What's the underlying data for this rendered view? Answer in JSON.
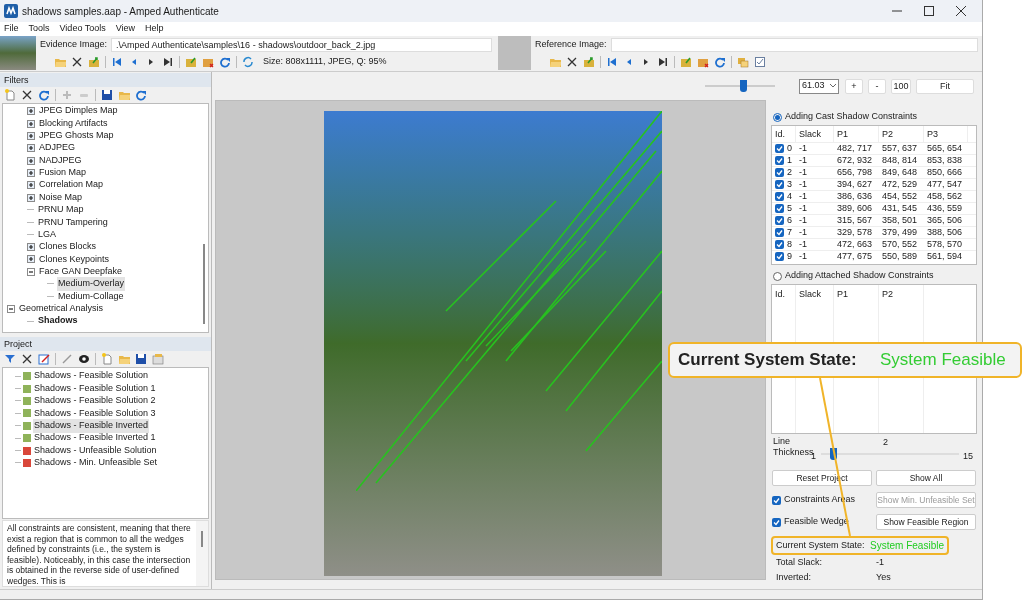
{
  "window": {
    "title": "shadows samples.aap - Amped Authenticate"
  },
  "menu": [
    "File",
    "Tools",
    "Video Tools",
    "View",
    "Help"
  ],
  "evidence": {
    "label": "Evidence Image:",
    "path": ".\\Amped Authenticate\\samples\\16 - shadows\\outdoor_back_2.jpg",
    "info": "Size: 808x1111, JPEG, Q: 95%"
  },
  "reference": {
    "label": "Reference Image:"
  },
  "filters": {
    "title": "Filters",
    "continued_children": [
      {
        "label": "JPEG Dimples Map",
        "expanded": false,
        "selected": false,
        "active": false
      },
      {
        "label": "Blocking Artifacts",
        "expanded": false,
        "selected": false,
        "active": false
      },
      {
        "label": "JPEG Ghosts Map",
        "expanded": false,
        "selected": false,
        "active": false
      },
      {
        "label": "ADJPEG",
        "expanded": false,
        "selected": false,
        "active": false
      },
      {
        "label": "NADJPEG",
        "expanded": false,
        "selected": false,
        "active": false
      },
      {
        "label": "Fusion Map",
        "expanded": false,
        "selected": false,
        "active": false
      },
      {
        "label": "Correlation Map",
        "expanded": false,
        "selected": false,
        "active": false
      },
      {
        "label": "Noise Map",
        "expanded": false,
        "selected": false,
        "active": false
      },
      {
        "label": "PRNU Map",
        "selected": false,
        "active": false
      },
      {
        "label": "PRNU Tampering",
        "selected": false,
        "active": false
      },
      {
        "label": "LGA",
        "selected": false,
        "active": false
      },
      {
        "label": "Clones Blocks",
        "expanded": false,
        "selected": false,
        "active": false
      },
      {
        "label": "Clones Keypoints",
        "expanded": false,
        "selected": false,
        "active": false
      },
      {
        "label": "Face GAN Deepfake",
        "expanded": true,
        "selected": false,
        "active": false,
        "children": [
          {
            "label": "Medium-Overlay",
            "selected": true,
            "active": false
          },
          {
            "label": "Medium-Collage",
            "selected": false,
            "active": false
          }
        ]
      }
    ],
    "nodes": [
      {
        "label": "Geometrical Analysis",
        "expanded": true,
        "selected": false,
        "active": false,
        "children": [
          {
            "label": "Shadows",
            "selected": false,
            "active": true
          }
        ]
      }
    ]
  },
  "project": {
    "title": "Project",
    "items": [
      {
        "label": "Shadows - Feasible Solution",
        "color": "#8fb35a",
        "selected": false
      },
      {
        "label": "Shadows - Feasible Solution 1",
        "color": "#8fb35a",
        "selected": false
      },
      {
        "label": "Shadows - Feasible Solution 2",
        "color": "#8fb35a",
        "selected": false
      },
      {
        "label": "Shadows - Feasible Solution 3",
        "color": "#8fb35a",
        "selected": false
      },
      {
        "label": "Shadows - Feasible Inverted",
        "color": "#8fb35a",
        "selected": true
      },
      {
        "label": "Shadows - Feasible Inverted 1",
        "color": "#8fb35a",
        "selected": false
      },
      {
        "label": "Shadows - Unfeasible Solution",
        "color": "#d9473a",
        "selected": false
      },
      {
        "label": "Shadows - Min. Unfeasible Set",
        "color": "#d9473a",
        "selected": false
      }
    ],
    "description": "All constraints are consistent, meaning that there exist a region that is common to all the wedges defined by constraints (i.e., the system is feasible). Noticeably, in this case the intersection is obtained in the reverse side of user-defined wedges. This is"
  },
  "zoom": {
    "level": 0.55,
    "value": "61.03",
    "buttons": [
      "+",
      "-",
      "100",
      "Fit"
    ]
  },
  "cast": {
    "label": "Adding Cast Shadow Constraints",
    "selected": true,
    "columns": [
      "Id.",
      "Slack",
      "P1",
      "P2",
      "P3"
    ],
    "rows": [
      {
        "checked": true,
        "cells": [
          "0",
          "-1",
          "482, 717",
          "557, 637",
          "565, 654"
        ]
      },
      {
        "checked": true,
        "cells": [
          "1",
          "-1",
          "672, 932",
          "848, 814",
          "853, 838"
        ]
      },
      {
        "checked": true,
        "cells": [
          "2",
          "-1",
          "656, 798",
          "849, 648",
          "850, 666"
        ]
      },
      {
        "checked": true,
        "cells": [
          "3",
          "-1",
          "394, 627",
          "472, 529",
          "477, 547"
        ]
      },
      {
        "checked": true,
        "cells": [
          "4",
          "-1",
          "386, 636",
          "454, 552",
          "458, 562"
        ]
      },
      {
        "checked": true,
        "cells": [
          "5",
          "-1",
          "389, 606",
          "431, 545",
          "436, 559"
        ]
      },
      {
        "checked": true,
        "cells": [
          "6",
          "-1",
          "315, 567",
          "358, 501",
          "365, 506"
        ]
      },
      {
        "checked": true,
        "cells": [
          "7",
          "-1",
          "329, 578",
          "379, 499",
          "388, 506"
        ]
      },
      {
        "checked": true,
        "cells": [
          "8",
          "-1",
          "472, 663",
          "570, 552",
          "578, 570"
        ]
      },
      {
        "checked": true,
        "cells": [
          "9",
          "-1",
          "477, 675",
          "550, 589",
          "561, 594"
        ]
      }
    ]
  },
  "attached": {
    "label": "Adding Attached Shadow Constraints",
    "selected": false,
    "columns": [
      "Id.",
      "Slack",
      "P1",
      "P2"
    ]
  },
  "thickness": {
    "label": "Line Thickness",
    "value": "2",
    "min": "1",
    "max": "15",
    "level": 0.07
  },
  "buttons": [
    {
      "label": "Reset Project",
      "disabled": false
    },
    {
      "label": "Show All",
      "disabled": false
    },
    {
      "label": "Show Min. Unfeasible Set",
      "disabled": true
    },
    {
      "label": "Show Feasible Region",
      "disabled": false
    }
  ],
  "checks": [
    {
      "label": "Constraints Areas",
      "checked": true
    },
    {
      "label": "Feasible Wedge",
      "checked": true
    }
  ],
  "status": [
    {
      "label": "Current System State:",
      "value": "System Feasible",
      "highlighted": true,
      "color": "#22cc22"
    },
    {
      "label": "Total Slack:",
      "value": "-1",
      "highlighted": false
    },
    {
      "label": "Inverted:",
      "value": "Yes",
      "highlighted": false
    }
  ],
  "callout": {
    "label": "Current System State:",
    "value": "System Feasible"
  }
}
